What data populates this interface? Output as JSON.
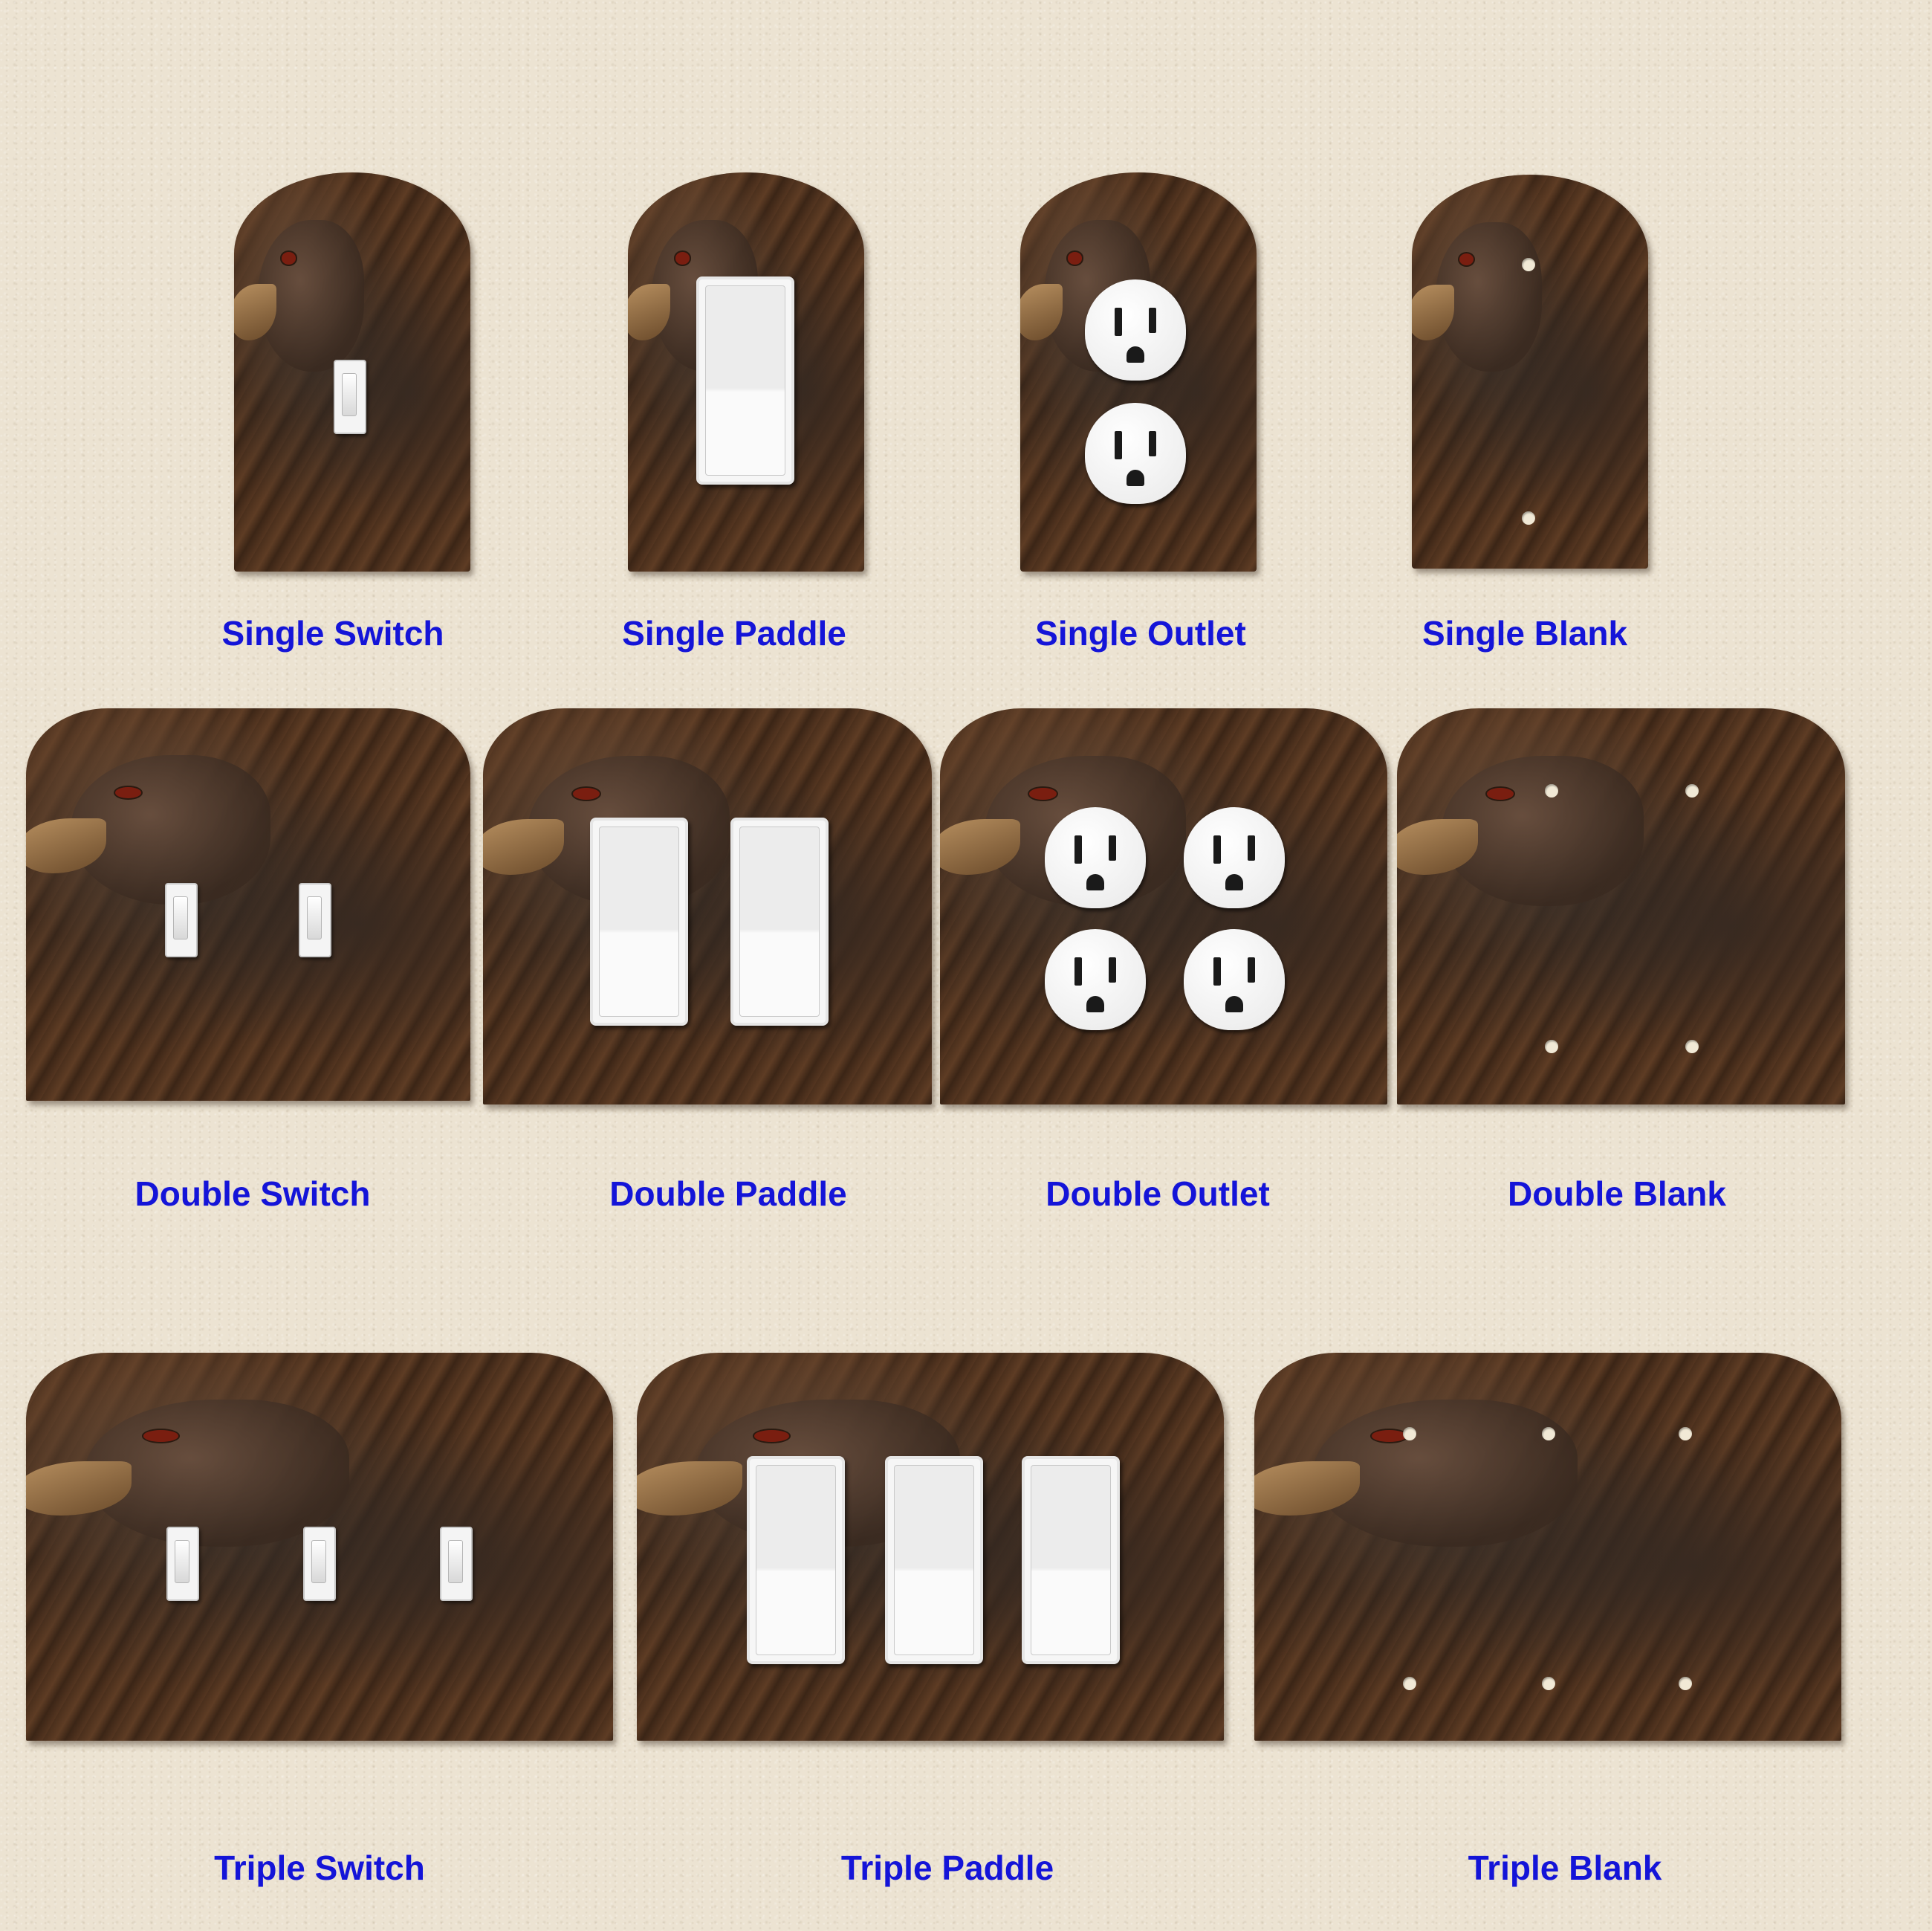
{
  "labels": {
    "single_switch": "Single Switch",
    "single_paddle": "Single Paddle",
    "single_outlet": "Single Outlet",
    "single_blank": "Single Blank",
    "double_switch": "Double Switch",
    "double_paddle": "Double Paddle",
    "double_outlet": "Double Outlet",
    "double_blank": "Double Blank",
    "triple_switch": "Triple Switch",
    "triple_paddle": "Triple Paddle",
    "triple_blank": "Triple Blank"
  },
  "colors": {
    "background": "#ece3d2",
    "label_text": "#1414d8",
    "plate_wood": "#4a2f1c",
    "device_white": "#f6f6f6"
  },
  "plate_artwork": "carved-wood-eagle"
}
